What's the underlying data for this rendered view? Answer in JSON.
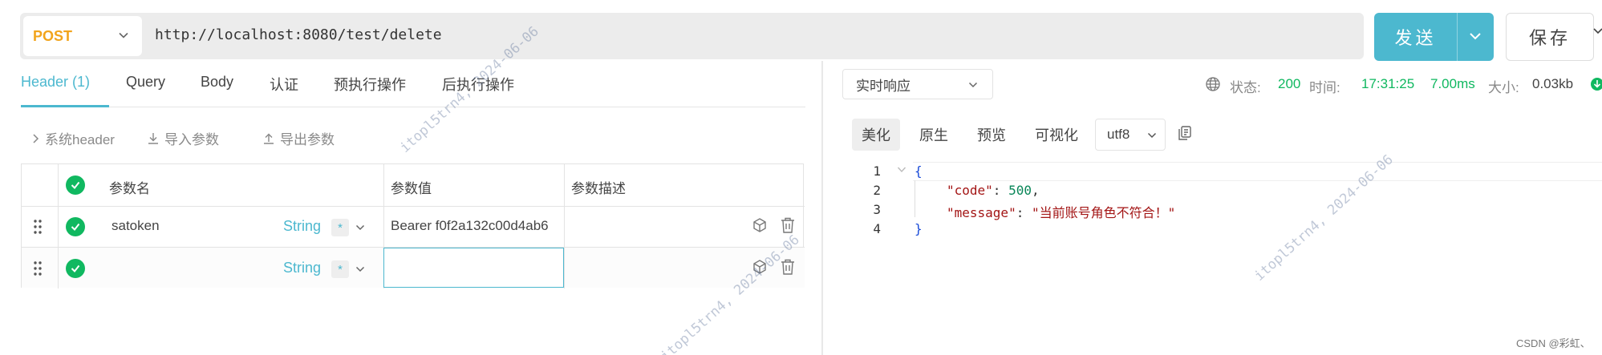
{
  "request": {
    "method": "POST",
    "url": "http://localhost:8080/test/delete",
    "send_label": "发送",
    "save_label": "保存"
  },
  "left_tabs": [
    "Header (1)",
    "Query",
    "Body",
    "认证",
    "预执行操作",
    "后执行操作"
  ],
  "toolbar": {
    "system_header": "系统header",
    "import_params": "导入参数",
    "export_params": "导出参数"
  },
  "table": {
    "columns": [
      "参数名",
      "参数值",
      "参数描述"
    ],
    "rows": [
      {
        "name": "satoken",
        "type": "String",
        "required": "*",
        "value": "Bearer f0f2a132c00d4ab6",
        "description": ""
      },
      {
        "name": "",
        "type": "String",
        "required": "*",
        "value": "",
        "description": ""
      }
    ]
  },
  "response": {
    "mode": "实时响应",
    "status_label": "状态:",
    "status": "200",
    "time_label": "时间:",
    "time": "17:31:25",
    "duration": "7.00ms",
    "size_label": "大小:",
    "size": "0.03kb",
    "view_tabs": [
      "美化",
      "原生",
      "预览",
      "可视化"
    ],
    "active_view": "美化",
    "encoding": "utf8",
    "code": {
      "line_numbers": [
        "1",
        "2",
        "3",
        "4"
      ],
      "open_brace": "{",
      "close_brace": "}",
      "code_key": "\"code\"",
      "code_value": "500",
      "message_key": "\"message\"",
      "message_value": "\"当前账号角色不符合！\""
    }
  },
  "watermark": "itopl5trn4, 2024-06-06",
  "footer": "CSDN @彩虹、",
  "colors": {
    "accent": "#4cb8cf",
    "method": "#f2a41c",
    "success": "#10b860"
  }
}
